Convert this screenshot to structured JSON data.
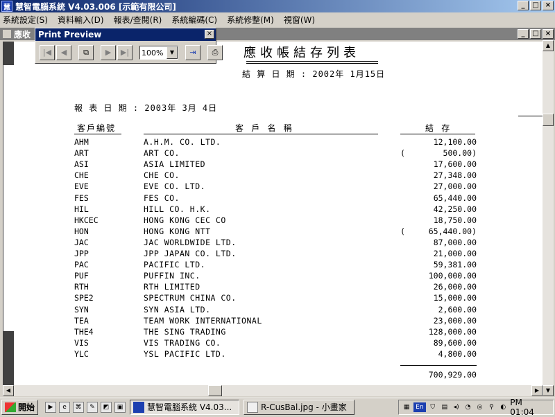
{
  "window": {
    "title": "慧智電腦系統 V4.03.006 [示範有限公司]"
  },
  "menu": [
    "系統設定(S)",
    "資料輸入(D)",
    "報表/查閱(R)",
    "系統編碼(C)",
    "系統修整(M)",
    "視窗(W)"
  ],
  "mdi": {
    "title": "應收"
  },
  "print_preview": {
    "title": "Print Preview",
    "zoom": "100%",
    "buttons": [
      "first-page",
      "prev-page",
      "pages",
      "next-page",
      "last-page",
      "exit",
      "print"
    ]
  },
  "report": {
    "title": "應收帳結存列表",
    "calc_date": "結 算 日 期 : 2002年 1月15日",
    "report_date": "報 表 日 期 : 2003年 3月 4日",
    "headers": {
      "code": "客戶編號",
      "name": "客 戶 名 稱",
      "balance": "結 存"
    },
    "rows": [
      {
        "code": "AHM",
        "name": "A.H.M. CO. LTD.",
        "amount": "12,100.00",
        "neg": false
      },
      {
        "code": "ART",
        "name": "ART CO.",
        "amount": "500.00)",
        "neg": true
      },
      {
        "code": "ASI",
        "name": "ASIA  LIMITED",
        "amount": "17,600.00",
        "neg": false
      },
      {
        "code": "CHE",
        "name": "CHE CO.",
        "amount": "27,348.00",
        "neg": false
      },
      {
        "code": "EVE",
        "name": "EVE CO. LTD.",
        "amount": "27,000.00",
        "neg": false
      },
      {
        "code": "FES",
        "name": "FES CO.",
        "amount": "65,440.00",
        "neg": false
      },
      {
        "code": "HIL",
        "name": "HILL CO. H.K.",
        "amount": "42,250.00",
        "neg": false
      },
      {
        "code": "HKCEC",
        "name": "HONG KONG CEC CO",
        "amount": "18,750.00",
        "neg": false
      },
      {
        "code": "HON",
        "name": "HONG KONG NTT",
        "amount": "65,440.00)",
        "neg": true
      },
      {
        "code": "JAC",
        "name": "JAC WORLDWIDE LTD.",
        "amount": "87,000.00",
        "neg": false
      },
      {
        "code": "JPP",
        "name": "JPP JAPAN CO. LTD.",
        "amount": "21,000.00",
        "neg": false
      },
      {
        "code": "PAC",
        "name": "PACIFIC  LTD.",
        "amount": "59,381.00",
        "neg": false
      },
      {
        "code": "PUF",
        "name": "PUFFIN INC.",
        "amount": "100,000.00",
        "neg": false
      },
      {
        "code": "RTH",
        "name": "RTH LIMITED",
        "amount": "26,000.00",
        "neg": false
      },
      {
        "code": "SPE2",
        "name": "SPECTRUM CHINA CO.",
        "amount": "15,000.00",
        "neg": false
      },
      {
        "code": "SYN",
        "name": "SYN ASIA LTD.",
        "amount": "2,600.00",
        "neg": false
      },
      {
        "code": "TEA",
        "name": "TEAM WORK INTERNATIONAL",
        "amount": "23,000.00",
        "neg": false
      },
      {
        "code": "THE4",
        "name": "THE SING TRADING",
        "amount": "128,000.00",
        "neg": false
      },
      {
        "code": "VIS",
        "name": "VIS TRADING CO.",
        "amount": "89,600.00",
        "neg": false
      },
      {
        "code": "YLC",
        "name": "YSL PACIFIC LTD.",
        "amount": "4,800.00",
        "neg": false
      }
    ],
    "total": "700,929.00"
  },
  "taskbar": {
    "start": "開始",
    "tasks": [
      {
        "label": "慧智電腦系統 V4.03...",
        "active": true
      },
      {
        "label": "R-CusBal.jpg - 小畫家",
        "active": false
      }
    ],
    "tray_lang": "En",
    "clock": "PM 01:04"
  }
}
